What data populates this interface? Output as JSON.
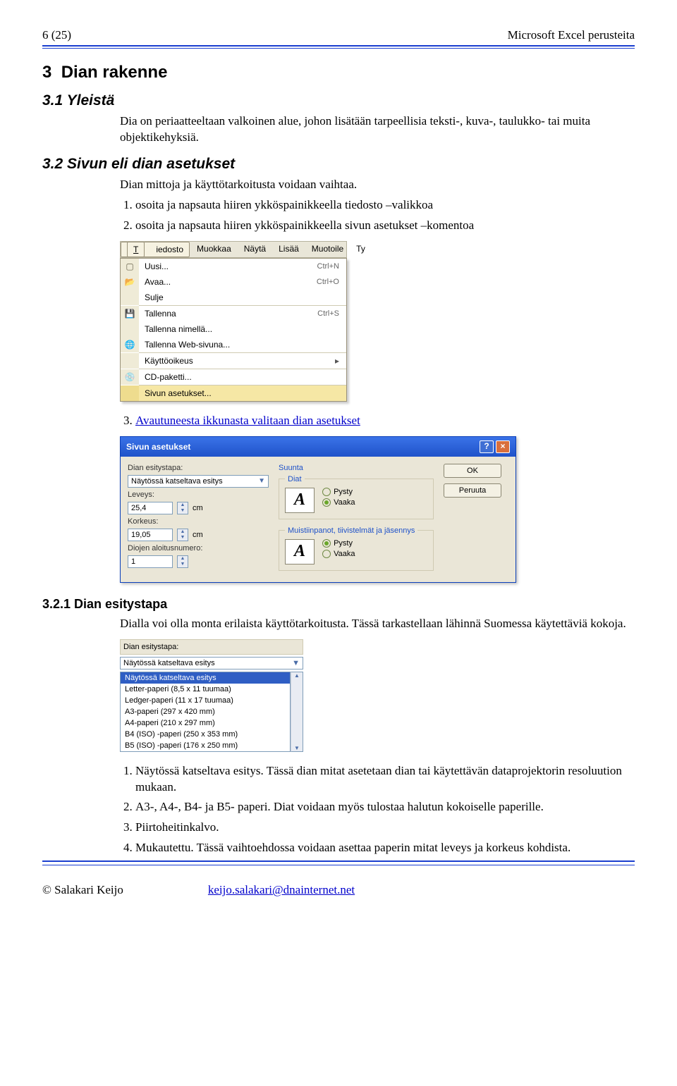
{
  "header": {
    "left": "6 (25)",
    "right": "Microsoft Excel perusteita"
  },
  "section": {
    "num": "3",
    "title": "Dian rakenne"
  },
  "s31": {
    "heading": "3.1  Yleistä",
    "p1": "Dia on periaatteeltaan valkoinen alue, johon lisätään tarpeellisia teksti-, kuva-, taulukko- tai muita objektikehyksiä."
  },
  "s32": {
    "heading": "3.2  Sivun eli dian asetukset",
    "p1": "Dian mittoja ja käyttötarkoitusta voidaan vaihtaa.",
    "step1": "osoita ja napsauta hiiren ykköspainikkeella tiedosto –valikkoa",
    "step2": "osoita ja napsauta hiiren ykköspainikkeella sivun asetukset –komentoa",
    "step3link": "Avautuneesta ikkunasta valitaan dian asetukset"
  },
  "menu": {
    "bar": [
      "Tiedosto",
      "Muokkaa",
      "Näytä",
      "Lisää",
      "Muotoile",
      "Ty"
    ],
    "items": [
      {
        "label": "Uusi...",
        "shortcut": "Ctrl+N",
        "icon": "doc"
      },
      {
        "label": "Avaa...",
        "shortcut": "Ctrl+O",
        "icon": "open"
      },
      {
        "label": "Sulje",
        "shortcut": "",
        "icon": ""
      },
      {
        "sep": true
      },
      {
        "label": "Tallenna",
        "shortcut": "Ctrl+S",
        "icon": "save"
      },
      {
        "label": "Tallenna nimellä...",
        "shortcut": "",
        "icon": ""
      },
      {
        "label": "Tallenna Web-sivuna...",
        "shortcut": "",
        "icon": "web"
      },
      {
        "sep": true
      },
      {
        "label": "Käyttöoikeus",
        "shortcut": "",
        "submenu": true
      },
      {
        "sep": true
      },
      {
        "label": "CD-paketti...",
        "shortcut": "",
        "icon": "cd"
      },
      {
        "sep": true
      },
      {
        "label": "Sivun asetukset...",
        "shortcut": "",
        "selected": true
      }
    ]
  },
  "dialog": {
    "title": "Sivun asetukset",
    "help": "?",
    "close": "×",
    "esitystapa_label": "Dian esitystapa:",
    "esitystapa_value": "Näytössä katseltava esitys",
    "leveys_label": "Leveys:",
    "leveys_value": "25,4",
    "unit": "cm",
    "korkeus_label": "Korkeus:",
    "korkeus_value": "19,05",
    "aloitus_label": "Diojen aloitusnumero:",
    "aloitus_value": "1",
    "suunta": "Suunta",
    "diat": "Diat",
    "pysty": "Pysty",
    "vaaka": "Vaaka",
    "muisti": "Muistiinpanot, tiivistelmät ja jäsennys",
    "preview": "A",
    "ok": "OK",
    "cancel": "Peruuta"
  },
  "s321": {
    "heading": "3.2.1  Dian esitystapa",
    "p1": "Dialla voi olla monta erilaista käyttötarkoitusta. Tässä tarkastellaan lähinnä Suomessa käytettäviä kokoja."
  },
  "dropbox": {
    "cap": "Dian esitystapa:",
    "selected": "Näytössä katseltava esitys",
    "items": [
      "Näytössä katseltava esitys",
      "Letter-paperi (8,5 x 11 tuumaa)",
      "Ledger-paperi (11 x 17 tuumaa)",
      "A3-paperi (297 x 420 mm)",
      "A4-paperi (210 x 297 mm)",
      "B4 (ISO) -paperi (250 x 353 mm)",
      "B5 (ISO) -paperi (176 x 250 mm)"
    ]
  },
  "list321": {
    "i1": "Näytössä katseltava esitys. Tässä dian mitat asetetaan dian tai käytettävän dataprojektorin resoluution mukaan.",
    "i2": "A3-, A4-, B4- ja B5- paperi. Diat voidaan myös tulostaa halutun kokoiselle paperille.",
    "i3": "Piirtoheitinkalvo.",
    "i4": "Mukautettu. Tässä vaihtoehdossa voidaan asettaa paperin mitat leveys ja korkeus kohdista."
  },
  "footer": {
    "left": "© Salakari Keijo",
    "link": "keijo.salakari@dnainternet.net"
  }
}
